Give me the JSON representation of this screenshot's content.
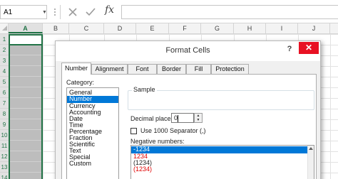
{
  "formula_bar": {
    "name_box": "A1",
    "cancel_icon": "x-icon",
    "enter_icon": "checkmark-icon",
    "function_label": "fx",
    "formula_value": ""
  },
  "sheet": {
    "columns": [
      "A",
      "B",
      "C",
      "D",
      "E",
      "F",
      "G",
      "H",
      "I",
      "J"
    ],
    "rows": [
      "1",
      "2",
      "3",
      "4",
      "5",
      "6",
      "7",
      "8",
      "9",
      "10",
      "11",
      "12",
      "13",
      "14"
    ],
    "selected_column": "A",
    "accent_color": "#217346"
  },
  "dialog": {
    "title": "Format Cells",
    "help_label": "?",
    "close_label": "✕",
    "tabs": [
      "Number",
      "Alignment",
      "Font",
      "Border",
      "Fill",
      "Protection"
    ],
    "active_tab": "Number",
    "category_label": "Category:",
    "categories": [
      "General",
      "Number",
      "Currency",
      "Accounting",
      "Date",
      "Time",
      "Percentage",
      "Fraction",
      "Scientific",
      "Text",
      "Special",
      "Custom"
    ],
    "selected_category": "Number",
    "sample_label": "Sample",
    "sample_value": "",
    "decimal_places_label": "Decimal places:",
    "decimal_places_value": "0",
    "use_separator_label": "Use 1000 Separator (,)",
    "use_separator_checked": false,
    "negative_numbers_label": "Negative numbers:",
    "negative_numbers": [
      {
        "text": "-1234",
        "color": "#000000",
        "selected": true
      },
      {
        "text": "1234",
        "color": "#e00000",
        "selected": false
      },
      {
        "text": "(1234)",
        "color": "#000000",
        "selected": false
      },
      {
        "text": "(1234)",
        "color": "#e00000",
        "selected": false
      }
    ],
    "selection_color": "#0078d7",
    "close_color": "#e81123"
  }
}
